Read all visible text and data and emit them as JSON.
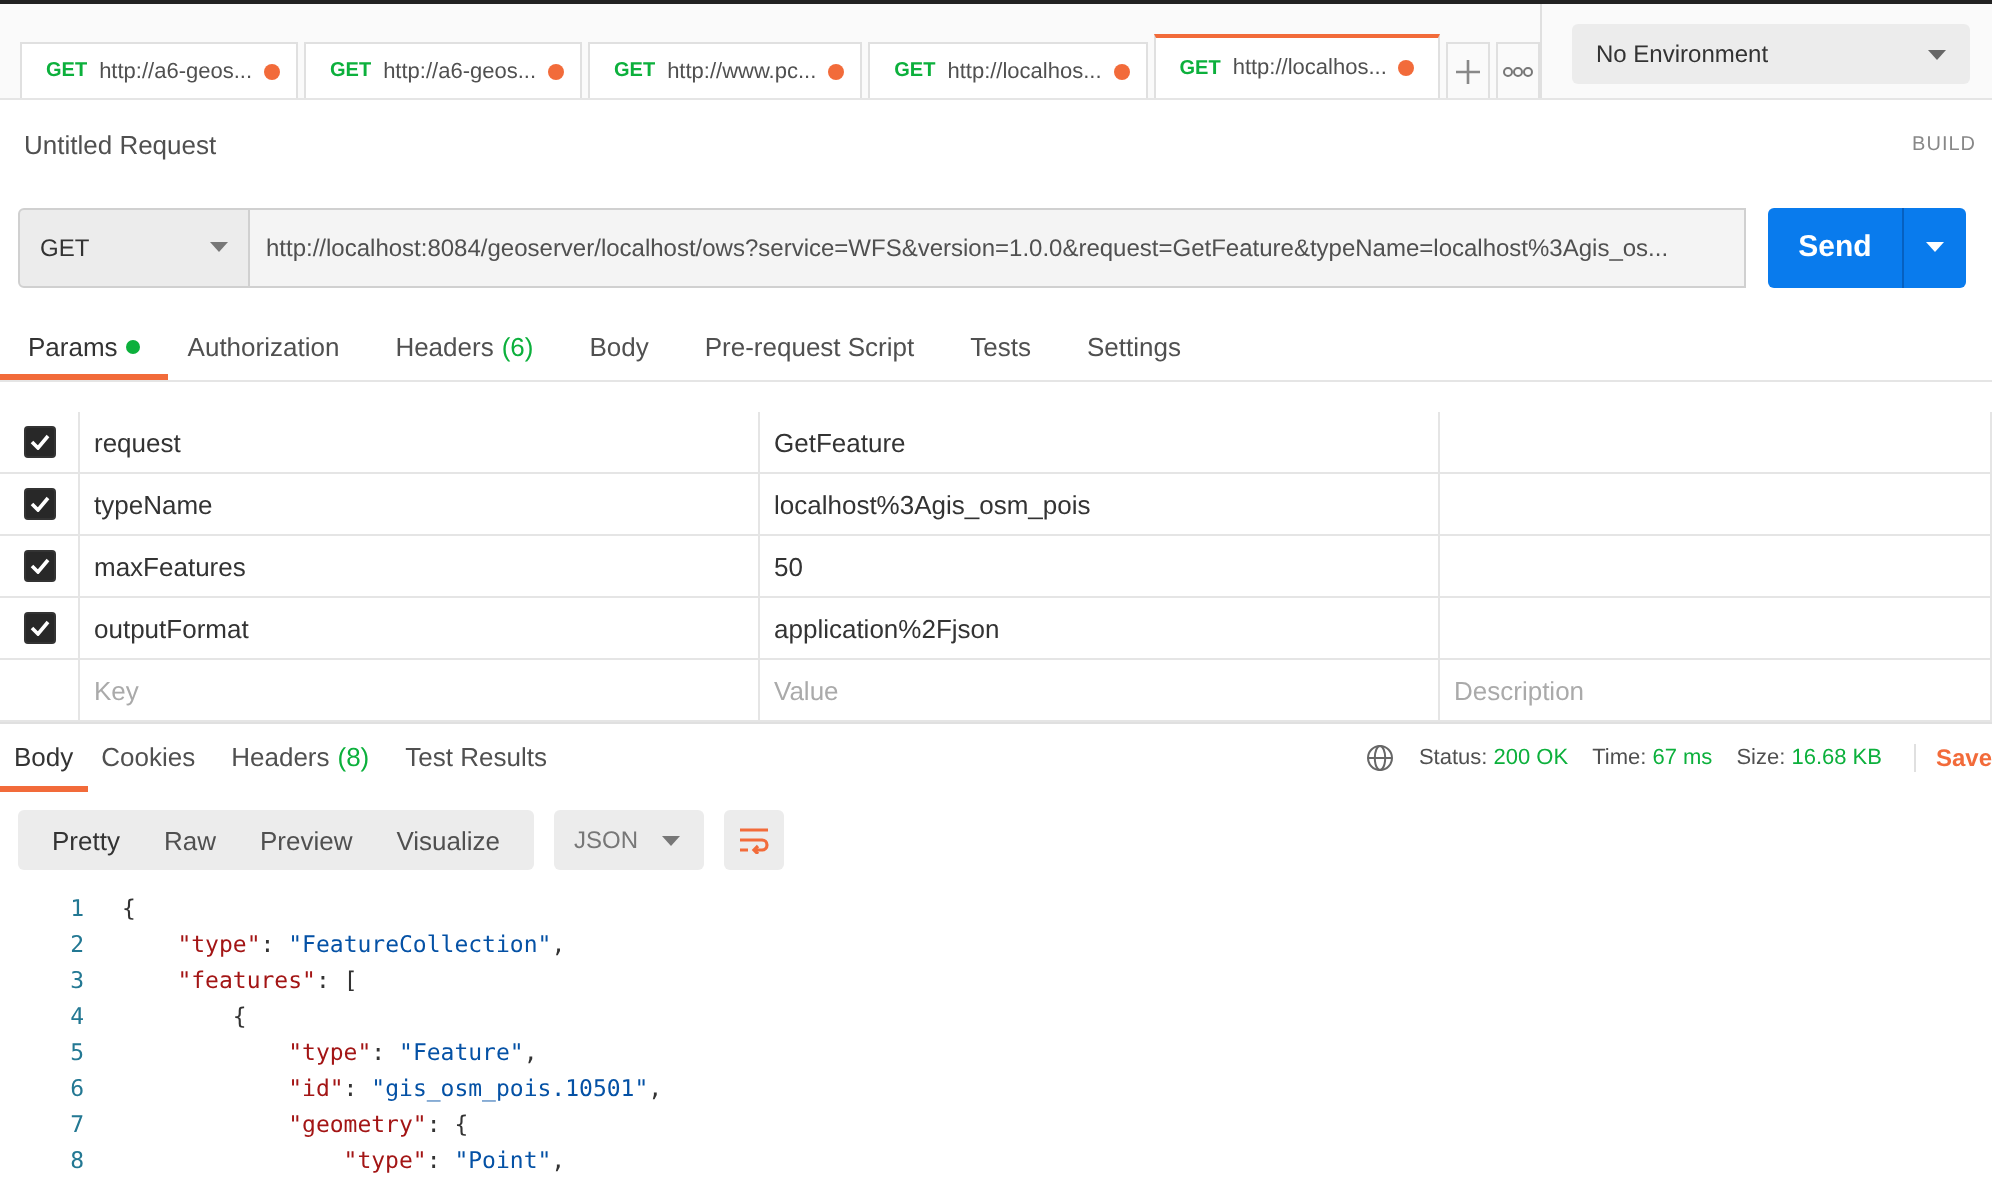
{
  "tabs": [
    {
      "method": "GET",
      "label": "http://a6-geos...",
      "unsaved": true,
      "selected": false
    },
    {
      "method": "GET",
      "label": "http://a6-geos...",
      "unsaved": true,
      "selected": false
    },
    {
      "method": "GET",
      "label": "http://www.pc...",
      "unsaved": true,
      "selected": false
    },
    {
      "method": "GET",
      "label": "http://localhos...",
      "unsaved": true,
      "selected": false
    },
    {
      "method": "GET",
      "label": "http://localhos...",
      "unsaved": true,
      "selected": true
    }
  ],
  "environment": "No Environment",
  "request_title": "Untitled Request",
  "build_label": "BUILD",
  "method": "GET",
  "url": "http://localhost:8084/geoserver/localhost/ows?service=WFS&version=1.0.0&request=GetFeature&typeName=localhost%3Agis_os...",
  "send_label": "Send",
  "request_tabs": [
    {
      "label": "Params",
      "dot": true,
      "selected": true
    },
    {
      "label": "Authorization",
      "dot": false,
      "selected": false
    },
    {
      "label": "Headers",
      "count": "(6)",
      "dot": false,
      "selected": false
    },
    {
      "label": "Body",
      "dot": false,
      "selected": false
    },
    {
      "label": "Pre-request Script",
      "dot": false,
      "selected": false
    },
    {
      "label": "Tests",
      "dot": false,
      "selected": false
    },
    {
      "label": "Settings",
      "dot": false,
      "selected": false
    }
  ],
  "params": [
    {
      "key": "request",
      "value": "GetFeature",
      "checked": true
    },
    {
      "key": "typeName",
      "value": "localhost%3Agis_osm_pois",
      "checked": true
    },
    {
      "key": "maxFeatures",
      "value": "50",
      "checked": true
    },
    {
      "key": "outputFormat",
      "value": "application%2Fjson",
      "checked": true
    }
  ],
  "new_param": {
    "key": {
      "placeholder": "Key"
    },
    "value": {
      "placeholder": "Value"
    },
    "description": {
      "placeholder": "Description"
    }
  },
  "response_tabs": [
    {
      "label": "Body",
      "selected": true
    },
    {
      "label": "Cookies",
      "selected": false
    },
    {
      "label": "Headers",
      "count": "(8)",
      "selected": false
    },
    {
      "label": "Test Results",
      "selected": false
    }
  ],
  "status": [
    {
      "label": "Status:",
      "value": "200 OK"
    },
    {
      "label": "Time:",
      "value": "67 ms"
    },
    {
      "label": "Size:",
      "value": "16.68 KB"
    }
  ],
  "save_label": "Save",
  "view_modes": [
    {
      "label": "Pretty",
      "selected": true
    },
    {
      "label": "Raw",
      "selected": false
    },
    {
      "label": "Preview",
      "selected": false
    },
    {
      "label": "Visualize",
      "selected": false
    }
  ],
  "format": "JSON",
  "code_lines": [
    {
      "number": "1",
      "text": "{"
    },
    {
      "number": "2",
      "text": "    \"type\": \"FeatureCollection\","
    },
    {
      "number": "3",
      "text": "    \"features\": ["
    },
    {
      "number": "4",
      "text": "        {"
    },
    {
      "number": "5",
      "text": "            \"type\": \"Feature\","
    },
    {
      "number": "6",
      "text": "            \"id\": \"gis_osm_pois.10501\","
    },
    {
      "number": "7",
      "text": "            \"geometry\": {"
    },
    {
      "number": "8",
      "text": "                \"type\": \"Point\","
    }
  ]
}
